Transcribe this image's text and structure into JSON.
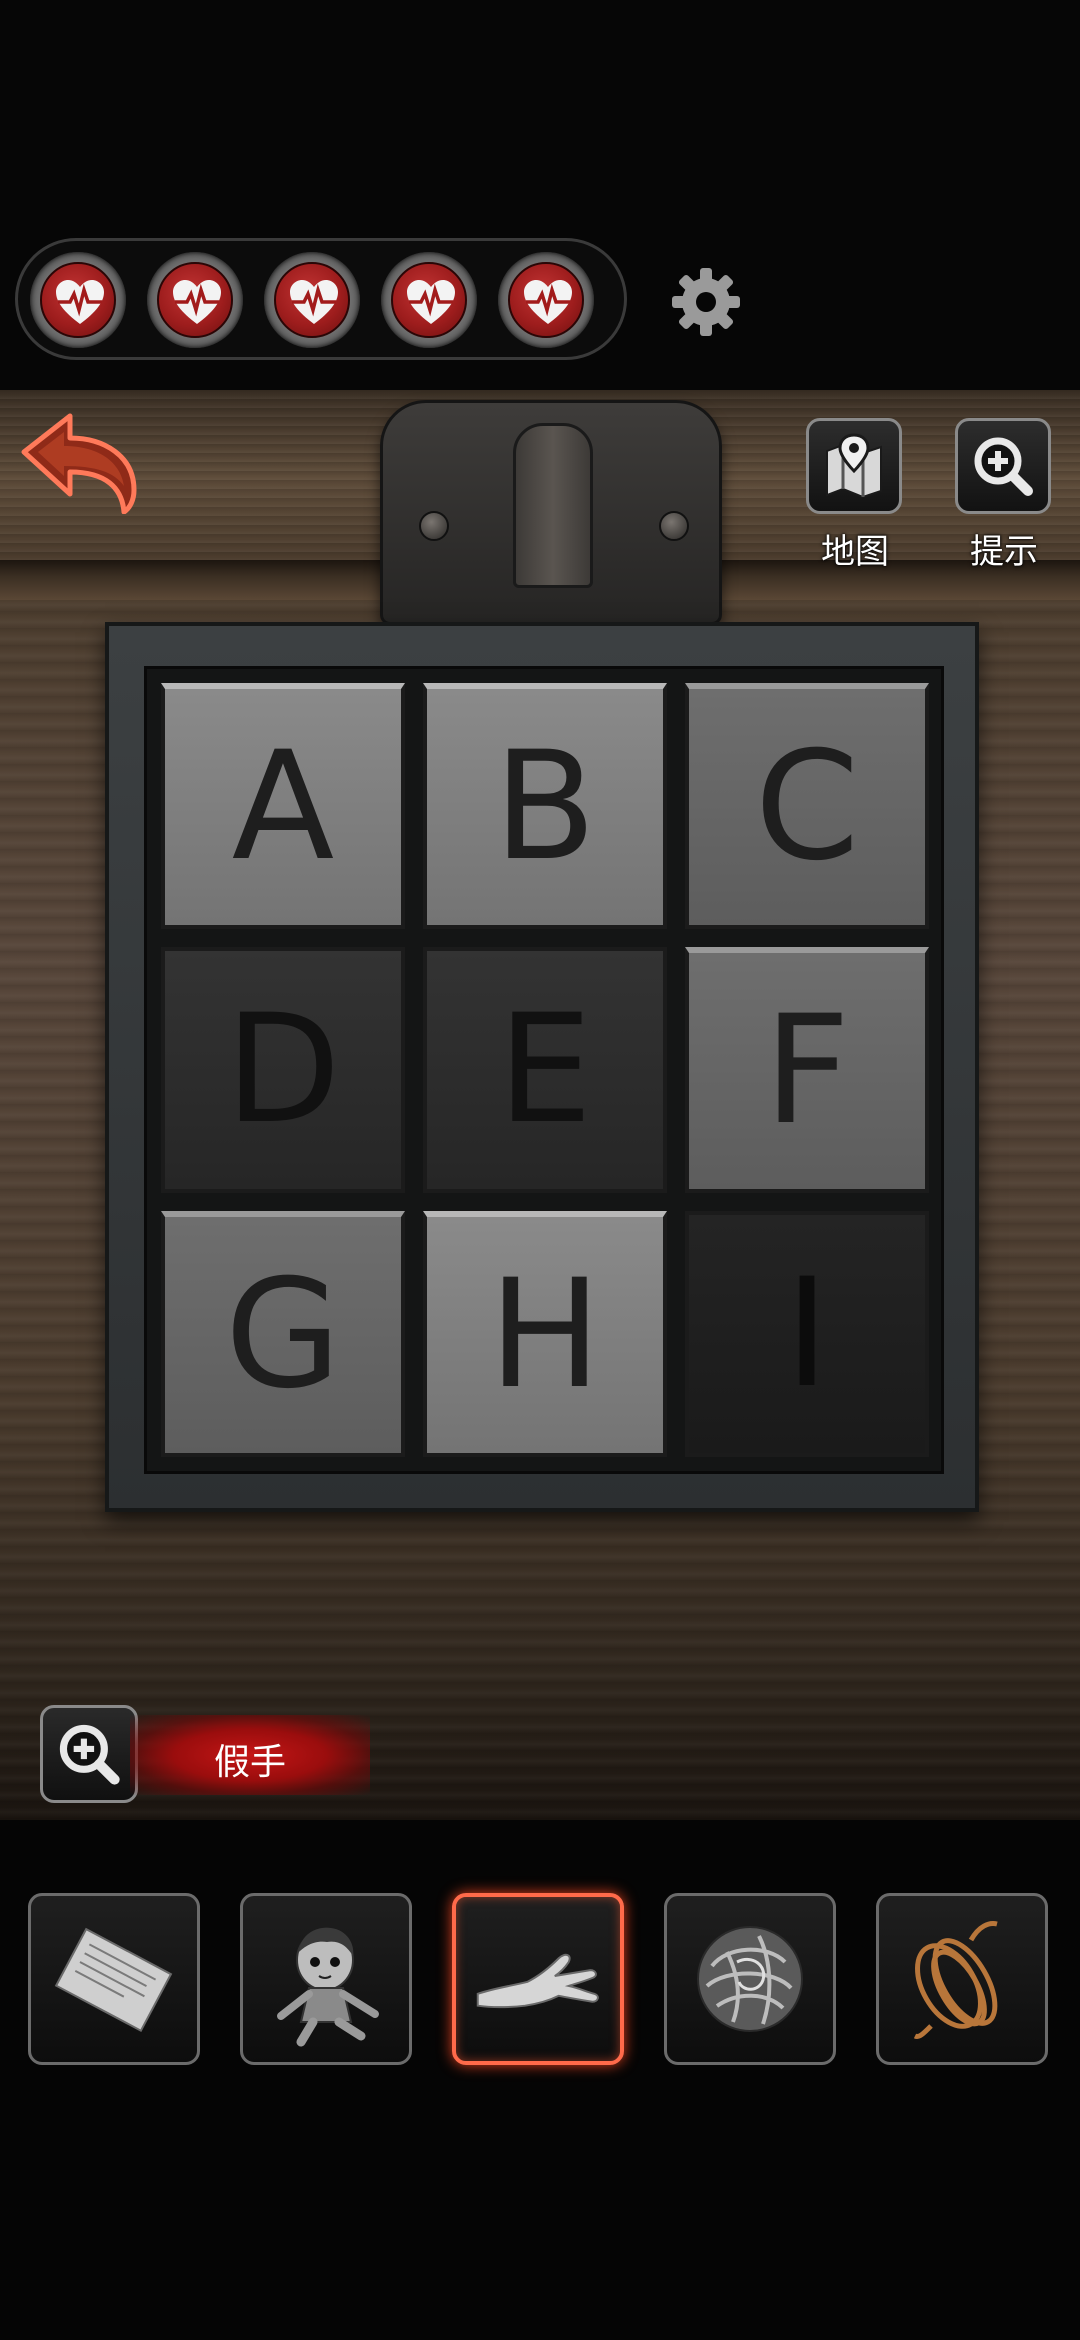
{
  "hud": {
    "lives": [
      {
        "icon": "heart-pulse-icon"
      },
      {
        "icon": "heart-pulse-icon"
      },
      {
        "icon": "heart-pulse-icon"
      },
      {
        "icon": "heart-pulse-icon"
      },
      {
        "icon": "heart-pulse-icon"
      }
    ],
    "settings_icon": "gear-icon",
    "back_icon": "back-arrow-icon"
  },
  "tools": {
    "map_label": "地图",
    "hint_label": "提示"
  },
  "puzzle": {
    "tiles": [
      {
        "letter": "A",
        "shade": "light"
      },
      {
        "letter": "B",
        "shade": "light"
      },
      {
        "letter": "C",
        "shade": "mid"
      },
      {
        "letter": "D",
        "shade": "dark"
      },
      {
        "letter": "E",
        "shade": "dark"
      },
      {
        "letter": "F",
        "shade": "mid"
      },
      {
        "letter": "G",
        "shade": "mid"
      },
      {
        "letter": "H",
        "shade": "light"
      },
      {
        "letter": "I",
        "shade": "darker"
      }
    ]
  },
  "selected_item": {
    "name": "假手"
  },
  "inventory": [
    {
      "item": "paper-note",
      "selected": false
    },
    {
      "item": "doll",
      "selected": false
    },
    {
      "item": "fake-hand",
      "selected": true
    },
    {
      "item": "steel-wool-ball",
      "selected": false
    },
    {
      "item": "rope",
      "selected": false
    }
  ],
  "colors": {
    "heart_red": "#9e1d1d",
    "selection_glow": "#ff6a4a",
    "item_label_bg": "#c41616"
  }
}
